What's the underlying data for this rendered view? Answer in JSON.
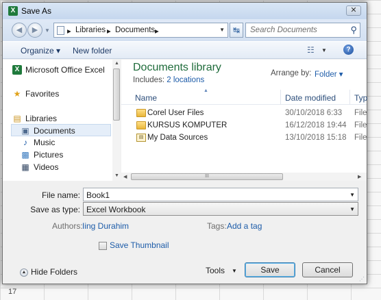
{
  "window": {
    "title": "Save As",
    "app_icon_letter": "X",
    "close_glyph": "✕"
  },
  "address": {
    "back_glyph": "◀",
    "forward_glyph": "▶",
    "breadcrumb": [
      "Libraries",
      "Documents"
    ],
    "separator": "▸",
    "refresh_glyph": "↹",
    "search_placeholder": "Search Documents"
  },
  "toolbar": {
    "organize_label": "Organize ▾",
    "new_folder_label": "New folder",
    "view_glyph": "☷"
  },
  "nav_pane": {
    "items": [
      {
        "label": "Microsoft Office Excel",
        "icon": "excel-icon",
        "glyph": "X"
      },
      {
        "label": "Favorites",
        "icon": "star-icon",
        "glyph": "★"
      },
      {
        "label": "Libraries",
        "icon": "libraries-icon",
        "glyph": "▤"
      },
      {
        "label": "Documents",
        "icon": "documents-icon",
        "glyph": "▣"
      },
      {
        "label": "Music",
        "icon": "music-icon",
        "glyph": "♪"
      },
      {
        "label": "Pictures",
        "icon": "pictures-icon",
        "glyph": "▩"
      },
      {
        "label": "Videos",
        "icon": "videos-icon",
        "glyph": "▦"
      }
    ],
    "selected": "Documents"
  },
  "library": {
    "title": "Documents library",
    "includes_label": "Includes:",
    "includes_link": "2 locations",
    "arrange_label": "Arrange by:",
    "arrange_value": "Folder ▾"
  },
  "columns": {
    "name": "Name",
    "date": "Date modified",
    "type": "Typ"
  },
  "files": [
    {
      "name": "Corel User Files",
      "date": "30/10/2018 6:33",
      "type": "File",
      "icon": "folder-icon"
    },
    {
      "name": "KURSUS KOMPUTER",
      "date": "16/12/2018 19:44",
      "type": "File",
      "icon": "folder-icon"
    },
    {
      "name": "My Data Sources",
      "date": "13/10/2018 15:18",
      "type": "File",
      "icon": "data-sources-folder-icon"
    }
  ],
  "scroll_grip": "III",
  "form": {
    "file_name_label": "File name:",
    "file_name_value": "Book1",
    "save_type_label": "Save as type:",
    "save_type_value": "Excel Workbook",
    "authors_label": "Authors:",
    "authors_value": "Iing Durahim",
    "tags_label": "Tags:",
    "tags_value": "Add a tag",
    "thumbnail_label": "Save Thumbnail"
  },
  "footer": {
    "hide_folders_label": "Hide Folders",
    "tools_label": "Tools",
    "save_label": "Save",
    "cancel_label": "Cancel"
  },
  "background": {
    "row_number": "17"
  }
}
